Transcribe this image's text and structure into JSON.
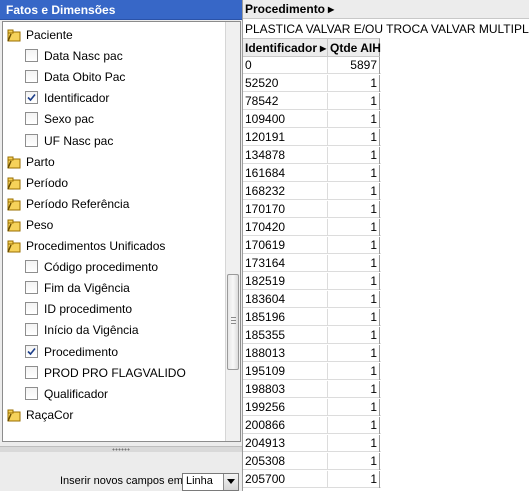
{
  "panel": {
    "title": "Fatos e Dimensões"
  },
  "tree": [
    {
      "type": "folder",
      "label": "Paciente"
    },
    {
      "type": "field",
      "label": "Data Nasc pac",
      "checked": false
    },
    {
      "type": "field",
      "label": "Data Obito Pac",
      "checked": false
    },
    {
      "type": "field",
      "label": "Identificador",
      "checked": true
    },
    {
      "type": "field",
      "label": "Sexo pac",
      "checked": false
    },
    {
      "type": "field",
      "label": "UF Nasc pac",
      "checked": false
    },
    {
      "type": "folder",
      "label": "Parto"
    },
    {
      "type": "folder",
      "label": "Período"
    },
    {
      "type": "folder",
      "label": "Período Referência"
    },
    {
      "type": "folder",
      "label": "Peso"
    },
    {
      "type": "folder",
      "label": "Procedimentos Unificados"
    },
    {
      "type": "field",
      "label": "Código procedimento",
      "checked": false
    },
    {
      "type": "field",
      "label": "Fim da Vigência",
      "checked": false
    },
    {
      "type": "field",
      "label": "ID procedimento",
      "checked": false
    },
    {
      "type": "field",
      "label": "Início da Vigência",
      "checked": false
    },
    {
      "type": "field",
      "label": "Procedimento",
      "checked": true
    },
    {
      "type": "field",
      "label": "PROD PRO FLAGVALIDO",
      "checked": false
    },
    {
      "type": "field",
      "label": "Qualificador",
      "checked": false
    },
    {
      "type": "folder",
      "label": "RaçaCor"
    }
  ],
  "insert": {
    "label": "Inserir novos campos em",
    "selected": "Linha"
  },
  "table": {
    "proc_header": "Procedimento",
    "proc_value": "PLASTICA VALVAR E/OU TROCA VALVAR MULTIPLA",
    "col_id": "Identificador",
    "col_qtde": "Qtde AIH",
    "rows": [
      {
        "id": "0",
        "qtde": "5897"
      },
      {
        "id": "52520",
        "qtde": "1"
      },
      {
        "id": "78542",
        "qtde": "1"
      },
      {
        "id": "109400",
        "qtde": "1"
      },
      {
        "id": "120191",
        "qtde": "1"
      },
      {
        "id": "134878",
        "qtde": "1"
      },
      {
        "id": "161684",
        "qtde": "1"
      },
      {
        "id": "168232",
        "qtde": "1"
      },
      {
        "id": "170170",
        "qtde": "1"
      },
      {
        "id": "170420",
        "qtde": "1"
      },
      {
        "id": "170619",
        "qtde": "1"
      },
      {
        "id": "173164",
        "qtde": "1"
      },
      {
        "id": "182519",
        "qtde": "1"
      },
      {
        "id": "183604",
        "qtde": "1"
      },
      {
        "id": "185196",
        "qtde": "1"
      },
      {
        "id": "185355",
        "qtde": "1"
      },
      {
        "id": "188013",
        "qtde": "1"
      },
      {
        "id": "195109",
        "qtde": "1"
      },
      {
        "id": "198803",
        "qtde": "1"
      },
      {
        "id": "199256",
        "qtde": "1"
      },
      {
        "id": "200866",
        "qtde": "1"
      },
      {
        "id": "204913",
        "qtde": "1"
      },
      {
        "id": "205308",
        "qtde": "1"
      },
      {
        "id": "205700",
        "qtde": "1"
      }
    ]
  },
  "colors": {
    "header_blue": "#3767c7",
    "panel_gray": "#ececec",
    "folder_gold": "#e8b21c"
  }
}
